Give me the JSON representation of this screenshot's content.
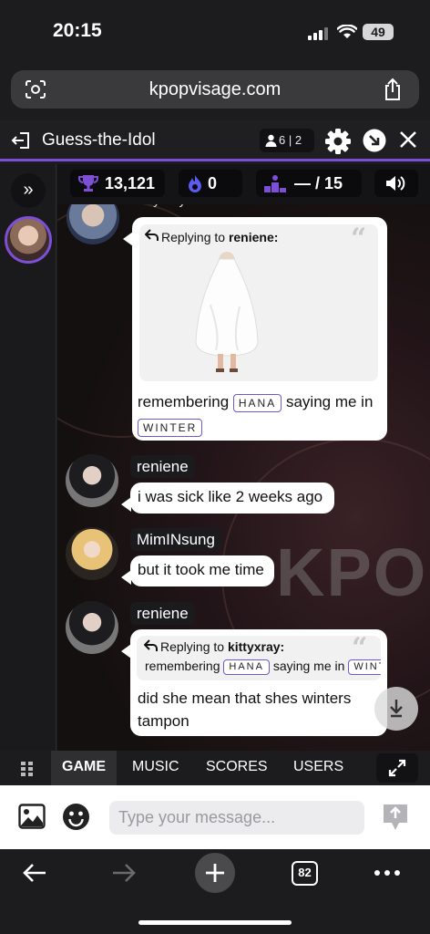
{
  "status_bar": {
    "time": "20:15",
    "battery": "49"
  },
  "browser": {
    "url": "kpopvisage.com",
    "tab_count": "82"
  },
  "game_header": {
    "title": "Guess-the-Idol",
    "players": "6 | 2"
  },
  "stats": {
    "score": "13,121",
    "streak": "0",
    "rank": "— / 15"
  },
  "watermark": "KPOP",
  "messages": [
    {
      "user": "kittyxray",
      "reply_label": "Replying to",
      "reply_to": "reniene:",
      "image_alt": "person in white sheet",
      "text_before": "remembering",
      "tag1": "HANA",
      "text_middle": "saying me in",
      "tag2": "WINTER"
    },
    {
      "user": "reniene",
      "text": "i was sick like 2 weeks ago"
    },
    {
      "user": "MimINsung",
      "text": "but it took me time"
    },
    {
      "user": "reniene",
      "reply_label": "Replying to",
      "reply_to": "kittyxray:",
      "quote_before": "remembering",
      "quote_tag1": "HANA",
      "quote_middle": "saying me in",
      "quote_tag2": "WINT",
      "text": "did she mean that shes winters tampon"
    }
  ],
  "tabs": [
    {
      "label": "GAME",
      "active": true
    },
    {
      "label": "MUSIC"
    },
    {
      "label": "SCORES"
    },
    {
      "label": "USERS"
    }
  ],
  "input": {
    "placeholder": "Type your message..."
  },
  "colors": {
    "accent": "#7d4fd6",
    "trophy": "#7d4fd6",
    "streak": "#5b5bf0"
  },
  "icons": [
    "reader-icon",
    "share-icon",
    "exit-icon",
    "person-icon",
    "gear-icon",
    "pip-icon",
    "close-icon",
    "expand-icon",
    "trophy-icon",
    "flame-icon",
    "podium-icon",
    "volume-icon",
    "reply-arrow-icon",
    "quote-icon",
    "scroll-down-icon",
    "grid-icon",
    "fullscreen-icon",
    "image-icon",
    "emoji-icon",
    "send-icon",
    "back-icon",
    "forward-icon",
    "plus-icon",
    "more-icon"
  ]
}
